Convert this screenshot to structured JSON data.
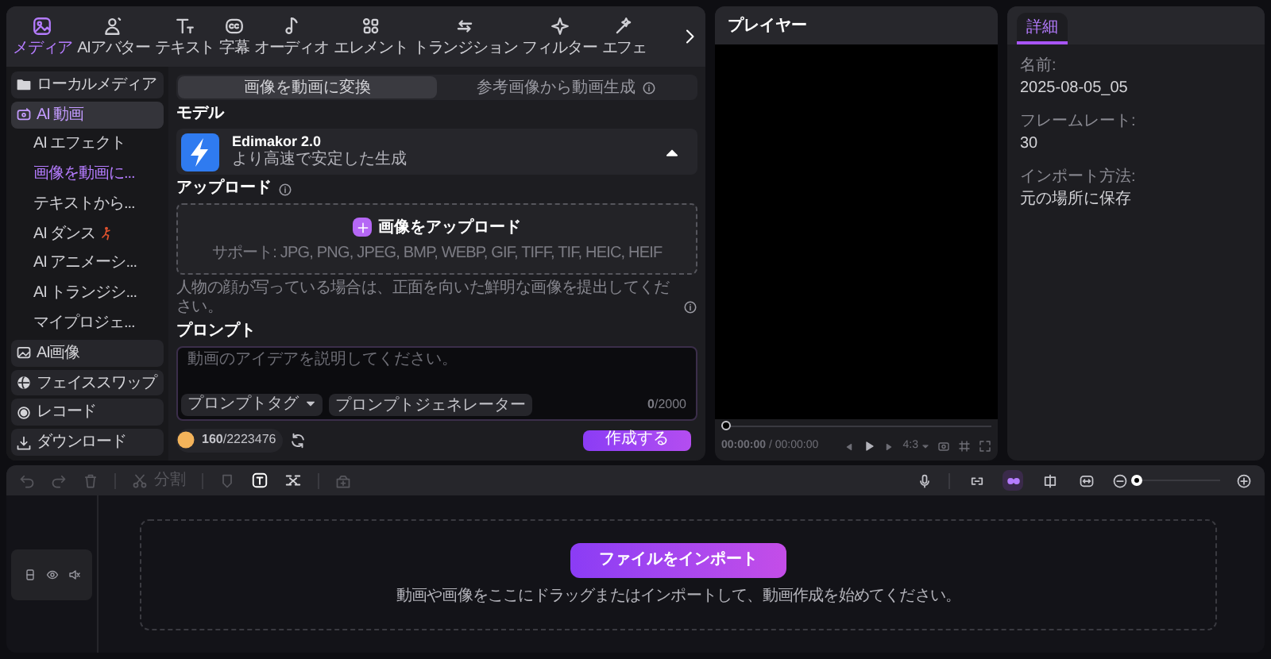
{
  "toolbar": {
    "tabs": [
      {
        "label": "メディア",
        "selected": true
      },
      {
        "label": "AIアバター",
        "selected": false
      },
      {
        "label": "テキスト",
        "selected": false
      },
      {
        "label": "字幕",
        "selected": false
      },
      {
        "label": "オーディオ",
        "selected": false
      },
      {
        "label": "エレメント",
        "selected": false
      },
      {
        "label": "トランジション",
        "selected": false
      },
      {
        "label": "フィルター",
        "selected": false
      },
      {
        "label": "エフェ",
        "selected": false
      }
    ]
  },
  "sidebar": {
    "items": [
      {
        "label": "ローカルメディア",
        "selected": false
      },
      {
        "label": "AI 動画",
        "selected": true,
        "expanded": true,
        "children": [
          {
            "label": "AI エフェクト",
            "selected": false
          },
          {
            "label": "画像を動画に...",
            "selected": true
          },
          {
            "label": "テキストから...",
            "selected": false
          },
          {
            "label": "AI ダンス",
            "selected": false
          },
          {
            "label": "AI アニメーシ...",
            "selected": false
          },
          {
            "label": "AI トランジシ...",
            "selected": false
          },
          {
            "label": "マイプロジェ...",
            "selected": false
          }
        ]
      },
      {
        "label": "AI画像",
        "selected": false
      },
      {
        "label": "フェイススワップ",
        "selected": false
      },
      {
        "label": "レコード",
        "selected": false
      },
      {
        "label": "ダウンロード",
        "selected": false
      }
    ]
  },
  "mode_tabs": [
    {
      "label": "画像を動画に変換",
      "selected": true
    },
    {
      "label": "参考画像から動画生成",
      "selected": false
    }
  ],
  "model": {
    "section_label": "モデル",
    "name": "Edimakor 2.0",
    "description": "より高速で安定した生成",
    "expanded": true
  },
  "upload": {
    "section_label": "アップロード",
    "button": "画像をアップロード",
    "formats": "サポート: JPG, PNG, JPEG, BMP, WEBP, GIF, TIFF, TIF, HEIC, HEIF",
    "note": "人物の顔が写っている場合は、正面を向いた鮮明な画像を提出してください。"
  },
  "prompt": {
    "section_label": "プロンプト",
    "placeholder": "動画のアイデアを説明してください。",
    "tag_button": "プロンプトタグ",
    "generator_button": "プロンプトジェネレーター",
    "counter": "**0**/2000"
  },
  "credits": "**160**/2223476",
  "create_button": "作成する",
  "player": {
    "title": "プレイヤー",
    "level": 0,
    "time": "**00:00:00** / 00:00:00",
    "aspect": "4:3"
  },
  "details": {
    "tabs": [
      {
        "label": "詳細",
        "selected": true
      }
    ],
    "fields": [
      {
        "label": "名前:",
        "value": "2025-08-05_05"
      },
      {
        "label": "フレームレート:",
        "value": "30"
      },
      {
        "label": "インポート方法:",
        "value": "元の場所に保存"
      }
    ]
  },
  "timeline": {
    "split_label": "分割",
    "modes": [
      {
        "selected": false
      },
      {
        "selected": true
      },
      {
        "selected": false
      },
      {
        "selected": false
      }
    ],
    "zoom": {
      "level": 0
    },
    "import_button": "ファイルをインポート",
    "hint": "動画や画像をここにドラッグまたはインポートして、動画作成を始めてください。"
  }
}
